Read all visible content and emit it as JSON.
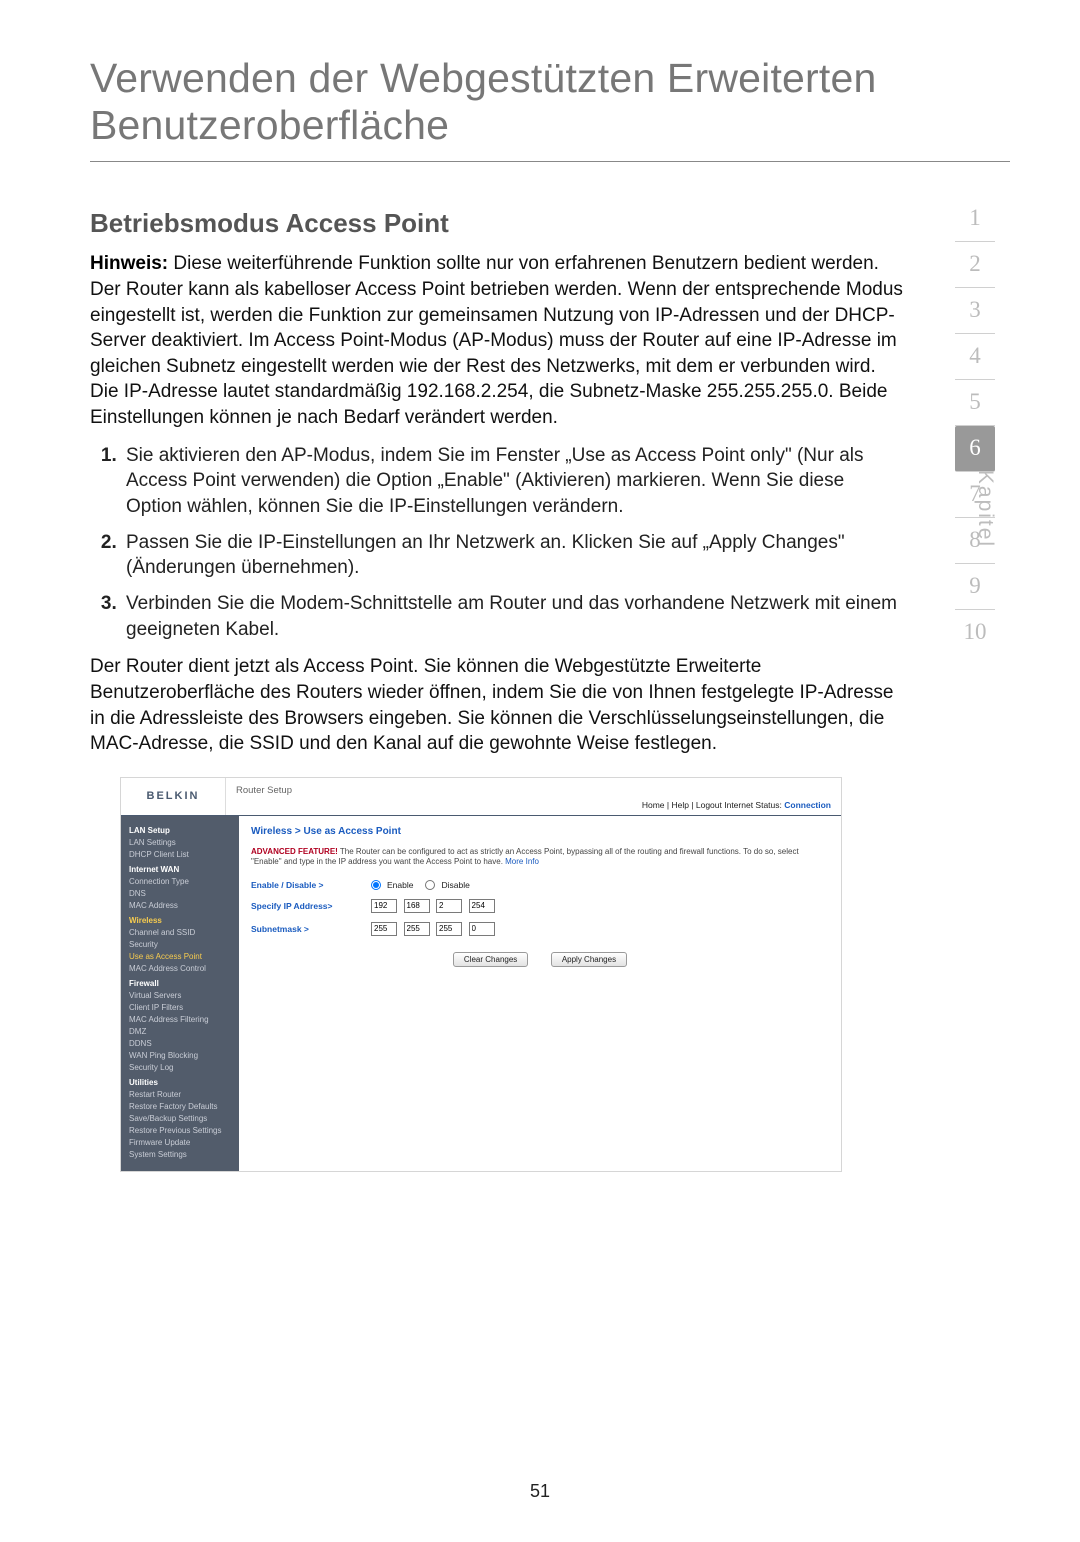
{
  "page_title": "Verwenden der Webgestützten Erweiterten Benutzeroberfläche",
  "section_heading": "Betriebsmodus Access Point",
  "intro_label": "Hinweis:",
  "intro_text": " Diese weiterführende Funktion sollte nur von erfahrenen Benutzern bedient werden. Der Router kann als kabelloser Access Point betrieben werden. Wenn der entsprechende Modus eingestellt ist, werden die Funktion zur gemeinsamen Nutzung von IP-Adressen und der DHCP-Server deaktiviert. Im Access Point-Modus (AP-Modus) muss der Router auf eine IP-Adresse im gleichen Subnetz eingestellt werden wie der Rest des Netzwerks, mit dem er verbunden wird. Die IP-Adresse lautet standardmäßig 192.168.2.254, die Subnetz-Maske 255.255.255.0. Beide Einstellungen können je nach Bedarf verändert werden.",
  "steps": [
    "Sie aktivieren den AP-Modus, indem Sie im Fenster „Use as Access Point only\" (Nur als Access Point verwenden) die Option „Enable\" (Aktivieren) markieren. Wenn Sie diese Option wählen, können Sie die IP-Einstellungen verändern.",
    "Passen Sie die IP-Einstellungen an Ihr Netzwerk an. Klicken Sie auf „Apply Changes\" (Änderungen übernehmen).",
    "Verbinden Sie die Modem-Schnittstelle am Router und das vorhandene Netzwerk mit einem geeigneten Kabel."
  ],
  "outro_text": "Der Router dient jetzt als Access Point. Sie können die Webgestützte Erweiterte Benutzeroberfläche des Routers wieder öffnen, indem Sie die von Ihnen festgelegte IP-Adresse in die Adressleiste des Browsers eingeben. Sie können die Verschlüsselungseinstellungen, die MAC-Adresse, die SSID und den Kanal auf die gewohnte Weise festlegen.",
  "chapter": {
    "label": "Kapitel",
    "items": [
      "1",
      "2",
      "3",
      "4",
      "5",
      "6",
      "7",
      "8",
      "9",
      "10"
    ],
    "current": "6"
  },
  "screenshot": {
    "brand": "BELKIN",
    "router_setup": "Router Setup",
    "top_links": "Home | Help | Logout   Internet Status: ",
    "top_status": "Connection",
    "sidebar": {
      "g1_header": "LAN Setup",
      "g1_items": [
        "LAN Settings",
        "DHCP Client List"
      ],
      "g2_header": "Internet WAN",
      "g2_items": [
        "Connection Type",
        "DNS",
        "MAC Address"
      ],
      "g3_header": "Wireless",
      "g3_items": [
        "Channel and SSID",
        "Security",
        "Use as Access Point",
        "MAC Address Control"
      ],
      "g4_header": "Firewall",
      "g4_items": [
        "Virtual Servers",
        "Client IP Filters",
        "MAC Address Filtering",
        "DMZ",
        "DDNS",
        "WAN Ping Blocking",
        "Security Log"
      ],
      "g5_header": "Utilities",
      "g5_items": [
        "Restart Router",
        "Restore Factory Defaults",
        "Save/Backup Settings",
        "Restore Previous Settings",
        "Firmware Update",
        "System Settings"
      ]
    },
    "breadcrumb": "Wireless > Use as Access Point",
    "adv_label": "ADVANCED FEATURE!",
    "adv_text": " The Router can be configured to act as strictly an Access Point, bypassing all of the routing and firewall functions. To do so, select \"Enable\" and type in the IP address you want the Access Point to have. ",
    "adv_more": "More Info",
    "form": {
      "enable_label": "Enable / Disable >",
      "enable_opt1": "Enable",
      "enable_opt2": "Disable",
      "ip_label": "Specify IP Address>",
      "ip": [
        "192",
        "168",
        "2",
        "254"
      ],
      "mask_label": "Subnetmask >",
      "mask": [
        "255",
        "255",
        "255",
        "0"
      ]
    },
    "buttons": {
      "clear": "Clear Changes",
      "apply": "Apply Changes"
    }
  },
  "page_number": "51"
}
